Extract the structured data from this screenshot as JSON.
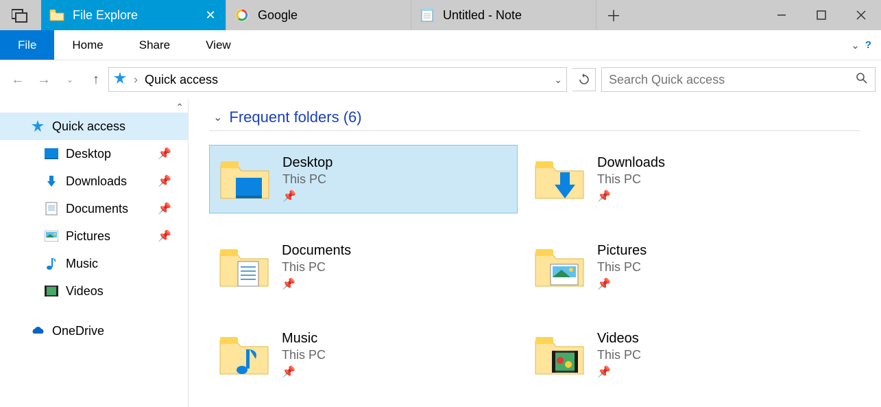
{
  "titlebar": {
    "tabs": [
      {
        "label": "File Explore",
        "icon": "folder-icon",
        "active": true
      },
      {
        "label": "Google",
        "icon": "google-icon",
        "active": false
      },
      {
        "label": "Untitled - Note",
        "icon": "notepad-icon",
        "active": false
      }
    ]
  },
  "ribbon": {
    "file": "File",
    "items": [
      "Home",
      "Share",
      "View"
    ]
  },
  "address": {
    "location": "Quick access",
    "search_placeholder": "Search Quick access"
  },
  "sidebar": {
    "quick_access": "Quick access",
    "items": [
      {
        "label": "Desktop",
        "icon": "desktop-icon",
        "pinned": true
      },
      {
        "label": "Downloads",
        "icon": "download-icon",
        "pinned": true
      },
      {
        "label": "Documents",
        "icon": "document-icon",
        "pinned": true
      },
      {
        "label": "Pictures",
        "icon": "pictures-icon",
        "pinned": true
      },
      {
        "label": "Music",
        "icon": "music-icon",
        "pinned": false
      },
      {
        "label": "Videos",
        "icon": "videos-icon",
        "pinned": false
      }
    ],
    "onedrive": "OneDrive"
  },
  "content": {
    "section_title": "Frequent folders (6)",
    "folders": [
      {
        "name": "Desktop",
        "location": "This PC",
        "icon": "desktop",
        "selected": true
      },
      {
        "name": "Downloads",
        "location": "This PC",
        "icon": "downloads",
        "selected": false
      },
      {
        "name": "Documents",
        "location": "This PC",
        "icon": "documents",
        "selected": false
      },
      {
        "name": "Pictures",
        "location": "This PC",
        "icon": "pictures",
        "selected": false
      },
      {
        "name": "Music",
        "location": "This PC",
        "icon": "music",
        "selected": false
      },
      {
        "name": "Videos",
        "location": "This PC",
        "icon": "videos",
        "selected": false
      }
    ]
  }
}
